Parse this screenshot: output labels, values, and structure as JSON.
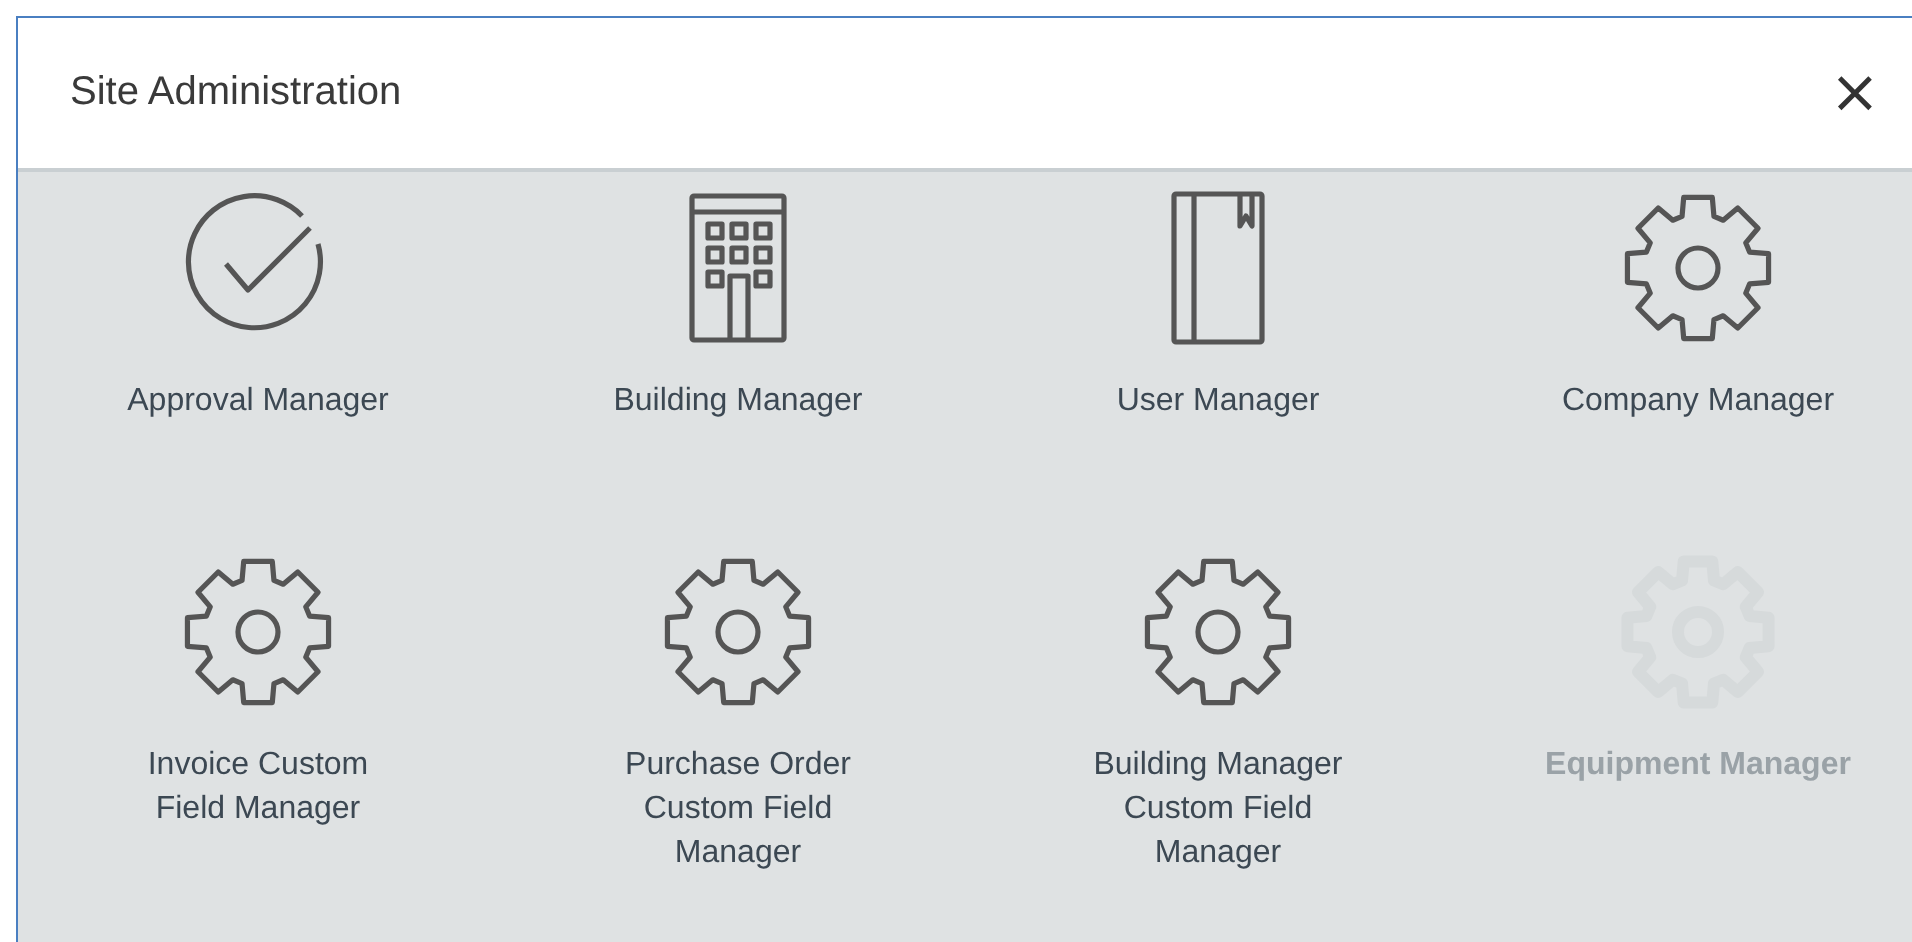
{
  "dialog": {
    "title": "Site Administration",
    "close": "×"
  },
  "items": [
    {
      "label": "Approval Manager",
      "kind": "approval",
      "disabled": false
    },
    {
      "label": "Building Manager",
      "kind": "building",
      "disabled": false
    },
    {
      "label": "User Manager",
      "kind": "user",
      "disabled": false
    },
    {
      "label": "Company Manager",
      "kind": "settings",
      "disabled": false
    },
    {
      "label": "Invoice Custom\nField Manager",
      "kind": "settings",
      "disabled": false
    },
    {
      "label": "Purchase Order\nCustom Field\nManager",
      "kind": "settings",
      "disabled": false
    },
    {
      "label": "Building Manager\nCustom Field\nManager",
      "kind": "settings",
      "disabled": false
    },
    {
      "label": "Equipment Manager",
      "kind": "settings",
      "disabled": true
    }
  ]
}
